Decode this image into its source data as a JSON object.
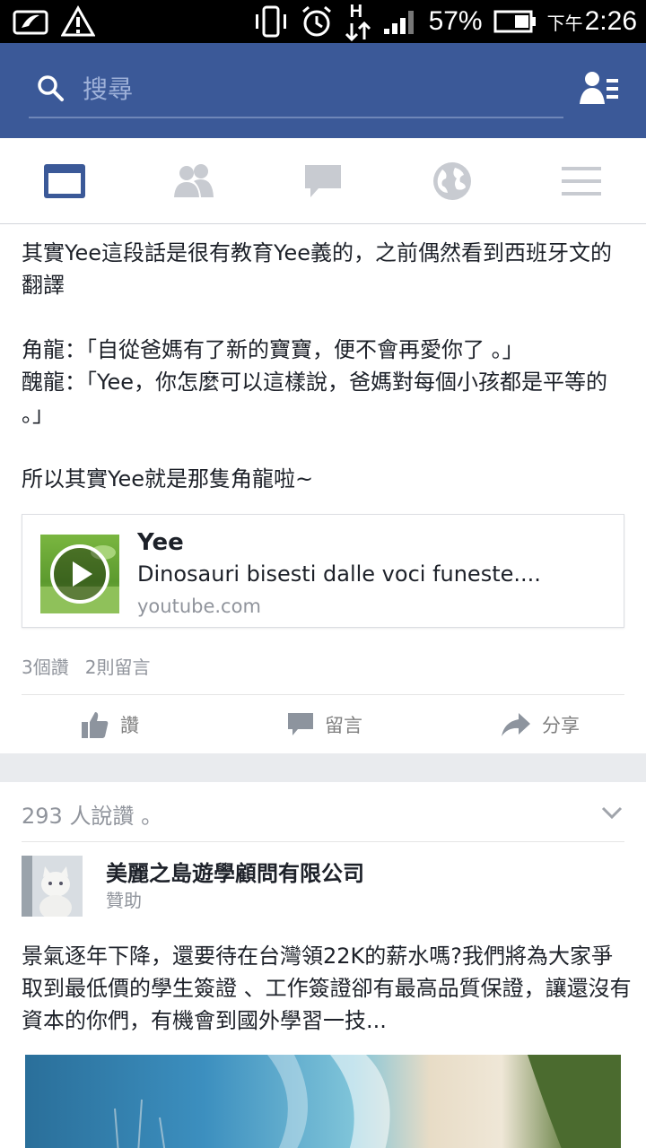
{
  "status_bar": {
    "battery": "57%",
    "time_prefix": "下午",
    "time": "2:26",
    "network": "H"
  },
  "search": {
    "placeholder": "搜尋"
  },
  "tabs": [
    {
      "icon": "news-feed-icon",
      "active": true
    },
    {
      "icon": "friends-icon",
      "active": false
    },
    {
      "icon": "messages-icon",
      "active": false
    },
    {
      "icon": "globe-icon",
      "active": false
    },
    {
      "icon": "menu-icon",
      "active": false
    }
  ],
  "post": {
    "text": "其實Yee這段話是很有教育Yee義的，之前偶然看到西班牙文的翻譯\n\n角龍：「自從爸媽有了新的寶寶，便不會再愛你了 。」\n醜龍：「Yee，你怎麼可以這樣說，爸媽對每個小孩都是平等的 。」\n\n所以其實Yee就是那隻角龍啦~",
    "link": {
      "title": "Yee",
      "description": "Dinosauri bisesti dalle voci funeste....",
      "domain": "youtube.com"
    },
    "likes_count": "3個讚",
    "comments_count": "2則留言",
    "actions": {
      "like": "讚",
      "comment": "留言",
      "share": "分享"
    }
  },
  "ad": {
    "likes_line": "293 人說讚 。",
    "page_name": "美麗之島遊學顧問有限公司",
    "sponsored": "贊助",
    "text": "景氣逐年下降，還要待在台灣領22K的薪水嗎?我們將為大家爭取到最低價的學生簽證 、工作簽證卻有最高品質保證，讓還沒有資本的你們，有機會到國外學習一技..."
  },
  "colors": {
    "brand": "#3b5998",
    "tab_active": "#3b5998",
    "tab_inactive": "#c8cbd1"
  }
}
